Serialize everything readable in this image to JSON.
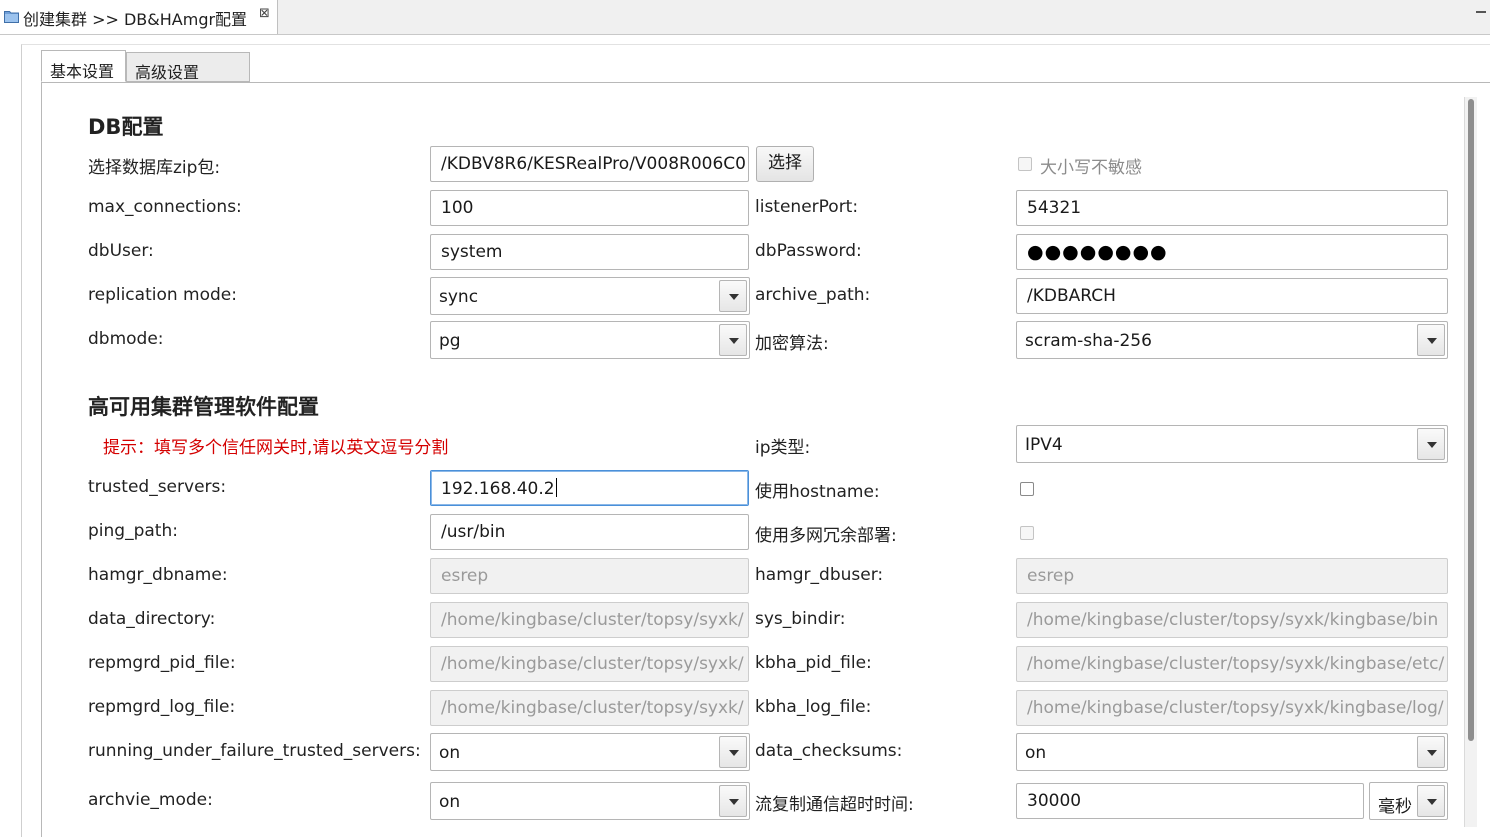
{
  "editor_tab": {
    "title": "创建集群 >> DB&HAmgr配置",
    "close": "⊠"
  },
  "tabs": {
    "basic": "基本设置",
    "advanced": "高级设置"
  },
  "db_section": {
    "title": "DB配置",
    "zip_label": "选择数据库zip包:",
    "zip_value": "/KDBV8R6/KESRealPro/V008R006C0",
    "choose_button": "选择",
    "case_insensitive_label": "大小写不敏感",
    "max_connections_label": "max_connections:",
    "max_connections_value": "100",
    "listener_port_label": "listenerPort:",
    "listener_port_value": "54321",
    "db_user_label": "dbUser:",
    "db_user_value": "system",
    "db_password_label": "dbPassword:",
    "db_password_value": "●●●●●●●●",
    "replication_mode_label": "replication mode:",
    "replication_mode_value": "sync",
    "archive_path_label": "archive_path:",
    "archive_path_value": "/KDBARCH",
    "dbmode_label": "dbmode:",
    "dbmode_value": "pg",
    "encryption_label": "加密算法:",
    "encryption_value": "scram-sha-256"
  },
  "ha_section": {
    "title": "高可用集群管理软件配置",
    "hint": "提示：填写多个信任网关时,请以英文逗号分割",
    "ip_type_label": "ip类型:",
    "ip_type_value": "IPV4",
    "trusted_servers_label": "trusted_servers:",
    "trusted_servers_value": "192.168.40.2",
    "use_hostname_label": "使用hostname:",
    "ping_path_label": "ping_path:",
    "ping_path_value": "/usr/bin",
    "multi_net_label": "使用多网冗余部署:",
    "hamgr_dbname_label": "hamgr_dbname:",
    "hamgr_dbname_value": "esrep",
    "hamgr_dbuser_label": "hamgr_dbuser:",
    "hamgr_dbuser_value": "esrep",
    "data_directory_label": "data_directory:",
    "data_directory_value": "/home/kingbase/cluster/topsy/syxk/",
    "sys_bindir_label": "sys_bindir:",
    "sys_bindir_value": "/home/kingbase/cluster/topsy/syxk/kingbase/bin",
    "repmgrd_pid_label": "repmgrd_pid_file:",
    "repmgrd_pid_value": "/home/kingbase/cluster/topsy/syxk/",
    "kbha_pid_label": "kbha_pid_file:",
    "kbha_pid_value": "/home/kingbase/cluster/topsy/syxk/kingbase/etc/",
    "repmgrd_log_label": "repmgrd_log_file:",
    "repmgrd_log_value": "/home/kingbase/cluster/topsy/syxk/",
    "kbha_log_label": "kbha_log_file:",
    "kbha_log_value": "/home/kingbase/cluster/topsy/syxk/kingbase/log/",
    "running_under_failure_label": "running_under_failure_trusted_servers:",
    "running_under_failure_value": "on",
    "data_checksums_label": "data_checksums:",
    "data_checksums_value": "on",
    "archive_mode_label": "archvie_mode:",
    "archive_mode_value": "on",
    "stream_timeout_label": "流复制通信超时时间:",
    "stream_timeout_value": "30000",
    "stream_timeout_unit": "毫秒"
  }
}
